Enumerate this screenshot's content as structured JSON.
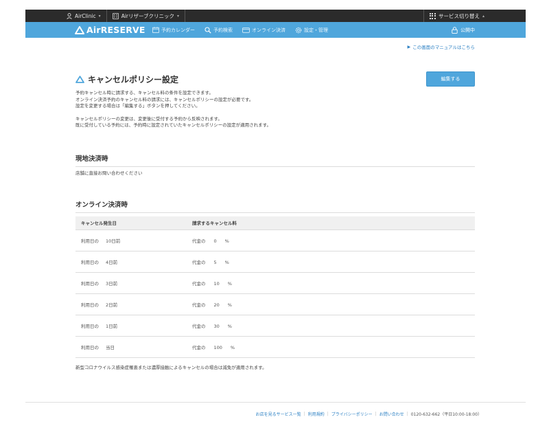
{
  "topbar": {
    "account": "AirClinic",
    "clinic": "Airリザーブクリニック",
    "switch_service": "サービス切り替え"
  },
  "navbar": {
    "brand": "AirRESERVE",
    "items": [
      {
        "label": "予約カレンダー",
        "icon": "calendar-icon"
      },
      {
        "label": "予約検索",
        "icon": "search-icon"
      },
      {
        "label": "オンライン決済",
        "icon": "card-icon"
      },
      {
        "label": "設定・管理",
        "icon": "gear-icon"
      }
    ],
    "status": "公開中"
  },
  "manual_link": "この画面のマニュアルはこちら",
  "page": {
    "title": "キャンセルポリシー設定",
    "edit_button": "編集する",
    "description": [
      "予約キャンセル時に請求する、キャンセル料の条件を設定できます。",
      "オンライン決済予約のキャンセル料の請求には、キャンセルポリシーの設定が必要です。",
      "設定を変更する場合は「編集する」ボタンを押してください。",
      "キャンセルポリシーの変更は、変更後に受付する予約から反映されます。",
      "既に受付している予約には、予約時に設定されていたキャンセルポリシーの設定が適用されます。"
    ]
  },
  "onsite": {
    "heading": "現地決済時",
    "body": "店舗に直接お問い合わせください"
  },
  "online": {
    "heading": "オンライン決済時",
    "columns": [
      "キャンセル発生日",
      "請求するキャンセル料"
    ],
    "rows": [
      {
        "prefix": "利用日の",
        "day": "10日前",
        "fee_prefix": "代金の",
        "value": "0",
        "unit": "%"
      },
      {
        "prefix": "利用日の",
        "day": "4日前",
        "fee_prefix": "代金の",
        "value": "5",
        "unit": "%"
      },
      {
        "prefix": "利用日の",
        "day": "3日前",
        "fee_prefix": "代金の",
        "value": "10",
        "unit": "%"
      },
      {
        "prefix": "利用日の",
        "day": "2日前",
        "fee_prefix": "代金の",
        "value": "20",
        "unit": "%"
      },
      {
        "prefix": "利用日の",
        "day": "1日前",
        "fee_prefix": "代金の",
        "value": "30",
        "unit": "%"
      },
      {
        "prefix": "利用日の",
        "day": "当日",
        "fee_prefix": "代金の",
        "value": "100",
        "unit": "%"
      }
    ],
    "footnote": "新型コロナウイルス感染症罹患または濃厚接触によるキャンセルの場合は減免が適用されます。"
  },
  "footer": {
    "links": [
      "お店を見るサービス一覧",
      "利用規約",
      "プライバシーポリシー",
      "お問い合わせ"
    ],
    "tel": "0120-632-662（平日10:00-18:00）"
  },
  "colors": {
    "topbar": "#2b2b2b",
    "navbar": "#4fa6dc",
    "link": "#2a7fc3",
    "button": "#4fa6dc"
  }
}
